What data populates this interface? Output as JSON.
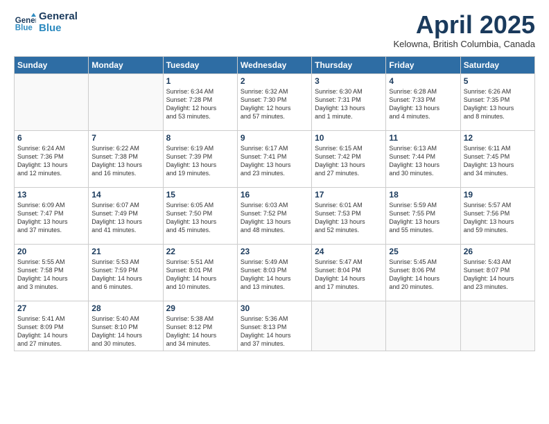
{
  "header": {
    "logo_line1": "General",
    "logo_line2": "Blue",
    "month": "April 2025",
    "location": "Kelowna, British Columbia, Canada"
  },
  "days_of_week": [
    "Sunday",
    "Monday",
    "Tuesday",
    "Wednesday",
    "Thursday",
    "Friday",
    "Saturday"
  ],
  "weeks": [
    [
      {
        "day": "",
        "info": ""
      },
      {
        "day": "",
        "info": ""
      },
      {
        "day": "1",
        "info": "Sunrise: 6:34 AM\nSunset: 7:28 PM\nDaylight: 12 hours\nand 53 minutes."
      },
      {
        "day": "2",
        "info": "Sunrise: 6:32 AM\nSunset: 7:30 PM\nDaylight: 12 hours\nand 57 minutes."
      },
      {
        "day": "3",
        "info": "Sunrise: 6:30 AM\nSunset: 7:31 PM\nDaylight: 13 hours\nand 1 minute."
      },
      {
        "day": "4",
        "info": "Sunrise: 6:28 AM\nSunset: 7:33 PM\nDaylight: 13 hours\nand 4 minutes."
      },
      {
        "day": "5",
        "info": "Sunrise: 6:26 AM\nSunset: 7:35 PM\nDaylight: 13 hours\nand 8 minutes."
      }
    ],
    [
      {
        "day": "6",
        "info": "Sunrise: 6:24 AM\nSunset: 7:36 PM\nDaylight: 13 hours\nand 12 minutes."
      },
      {
        "day": "7",
        "info": "Sunrise: 6:22 AM\nSunset: 7:38 PM\nDaylight: 13 hours\nand 16 minutes."
      },
      {
        "day": "8",
        "info": "Sunrise: 6:19 AM\nSunset: 7:39 PM\nDaylight: 13 hours\nand 19 minutes."
      },
      {
        "day": "9",
        "info": "Sunrise: 6:17 AM\nSunset: 7:41 PM\nDaylight: 13 hours\nand 23 minutes."
      },
      {
        "day": "10",
        "info": "Sunrise: 6:15 AM\nSunset: 7:42 PM\nDaylight: 13 hours\nand 27 minutes."
      },
      {
        "day": "11",
        "info": "Sunrise: 6:13 AM\nSunset: 7:44 PM\nDaylight: 13 hours\nand 30 minutes."
      },
      {
        "day": "12",
        "info": "Sunrise: 6:11 AM\nSunset: 7:45 PM\nDaylight: 13 hours\nand 34 minutes."
      }
    ],
    [
      {
        "day": "13",
        "info": "Sunrise: 6:09 AM\nSunset: 7:47 PM\nDaylight: 13 hours\nand 37 minutes."
      },
      {
        "day": "14",
        "info": "Sunrise: 6:07 AM\nSunset: 7:49 PM\nDaylight: 13 hours\nand 41 minutes."
      },
      {
        "day": "15",
        "info": "Sunrise: 6:05 AM\nSunset: 7:50 PM\nDaylight: 13 hours\nand 45 minutes."
      },
      {
        "day": "16",
        "info": "Sunrise: 6:03 AM\nSunset: 7:52 PM\nDaylight: 13 hours\nand 48 minutes."
      },
      {
        "day": "17",
        "info": "Sunrise: 6:01 AM\nSunset: 7:53 PM\nDaylight: 13 hours\nand 52 minutes."
      },
      {
        "day": "18",
        "info": "Sunrise: 5:59 AM\nSunset: 7:55 PM\nDaylight: 13 hours\nand 55 minutes."
      },
      {
        "day": "19",
        "info": "Sunrise: 5:57 AM\nSunset: 7:56 PM\nDaylight: 13 hours\nand 59 minutes."
      }
    ],
    [
      {
        "day": "20",
        "info": "Sunrise: 5:55 AM\nSunset: 7:58 PM\nDaylight: 14 hours\nand 3 minutes."
      },
      {
        "day": "21",
        "info": "Sunrise: 5:53 AM\nSunset: 7:59 PM\nDaylight: 14 hours\nand 6 minutes."
      },
      {
        "day": "22",
        "info": "Sunrise: 5:51 AM\nSunset: 8:01 PM\nDaylight: 14 hours\nand 10 minutes."
      },
      {
        "day": "23",
        "info": "Sunrise: 5:49 AM\nSunset: 8:03 PM\nDaylight: 14 hours\nand 13 minutes."
      },
      {
        "day": "24",
        "info": "Sunrise: 5:47 AM\nSunset: 8:04 PM\nDaylight: 14 hours\nand 17 minutes."
      },
      {
        "day": "25",
        "info": "Sunrise: 5:45 AM\nSunset: 8:06 PM\nDaylight: 14 hours\nand 20 minutes."
      },
      {
        "day": "26",
        "info": "Sunrise: 5:43 AM\nSunset: 8:07 PM\nDaylight: 14 hours\nand 23 minutes."
      }
    ],
    [
      {
        "day": "27",
        "info": "Sunrise: 5:41 AM\nSunset: 8:09 PM\nDaylight: 14 hours\nand 27 minutes."
      },
      {
        "day": "28",
        "info": "Sunrise: 5:40 AM\nSunset: 8:10 PM\nDaylight: 14 hours\nand 30 minutes."
      },
      {
        "day": "29",
        "info": "Sunrise: 5:38 AM\nSunset: 8:12 PM\nDaylight: 14 hours\nand 34 minutes."
      },
      {
        "day": "30",
        "info": "Sunrise: 5:36 AM\nSunset: 8:13 PM\nDaylight: 14 hours\nand 37 minutes."
      },
      {
        "day": "",
        "info": ""
      },
      {
        "day": "",
        "info": ""
      },
      {
        "day": "",
        "info": ""
      }
    ]
  ]
}
